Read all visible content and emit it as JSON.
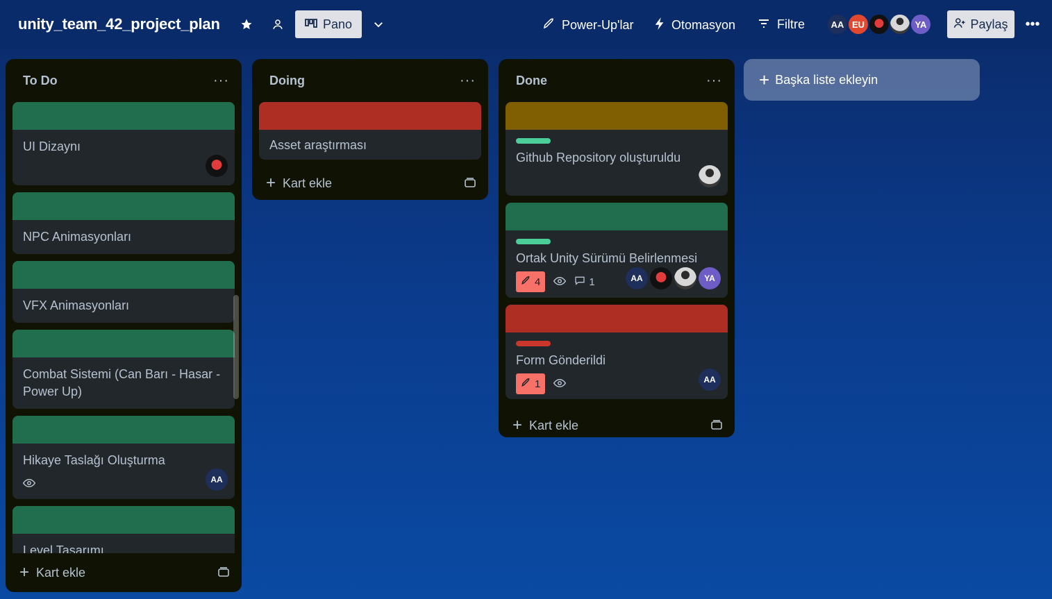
{
  "header": {
    "board_title": "unity_team_42_project_plan",
    "view_label": "Pano",
    "powerups_label": "Power-Up'lar",
    "automation_label": "Otomasyon",
    "filter_label": "Filtre",
    "share_label": "Paylaş",
    "members": [
      {
        "initials": "AA",
        "color": "#1d2f5a"
      },
      {
        "initials": "EU",
        "color": "#e2482d"
      },
      {
        "initials": "",
        "color": "#111111"
      },
      {
        "initials": "",
        "color": "#d8d8d8"
      },
      {
        "initials": "YA",
        "color": "#6e5dc6"
      }
    ]
  },
  "lists": [
    {
      "title": "To Do",
      "add_card_label": "Kart ekle",
      "cards": [
        {
          "title": "UI Dizaynı",
          "cover": "#216e4e"
        },
        {
          "title": "NPC Animasyonları",
          "cover": "#216e4e"
        },
        {
          "title": "VFX Animasyonları",
          "cover": "#216e4e"
        },
        {
          "title": "Combat Sistemi (Can Barı - Hasar - Power Up)",
          "cover": "#216e4e"
        },
        {
          "title": "Hikaye Taslağı Oluşturma",
          "cover": "#216e4e",
          "member": "AA"
        },
        {
          "title": "Level Tasarımı",
          "cover": "#216e4e"
        }
      ]
    },
    {
      "title": "Doing",
      "add_card_label": "Kart ekle",
      "cards": [
        {
          "title": "Asset araştırması",
          "cover": "#ae2e24"
        }
      ]
    },
    {
      "title": "Done",
      "add_card_label": "Kart ekle",
      "cards": [
        {
          "title": "Github Repository oluşturuldu",
          "cover": "#7f5f01",
          "label_color": "#4bce97"
        },
        {
          "title": "Ortak Unity Sürümü Belirlenmesi",
          "cover": "#216e4e",
          "label_color": "#4bce97",
          "checklist_count": "4",
          "comments": "1",
          "members": [
            "AA",
            "",
            "",
            "YA"
          ]
        },
        {
          "title": "Form Gönderildi",
          "cover": "#ae2e24",
          "label_color": "#c9372c",
          "checklist_count": "1",
          "members": [
            "AA"
          ]
        }
      ]
    }
  ],
  "add_list_label": "Başka liste ekleyin"
}
